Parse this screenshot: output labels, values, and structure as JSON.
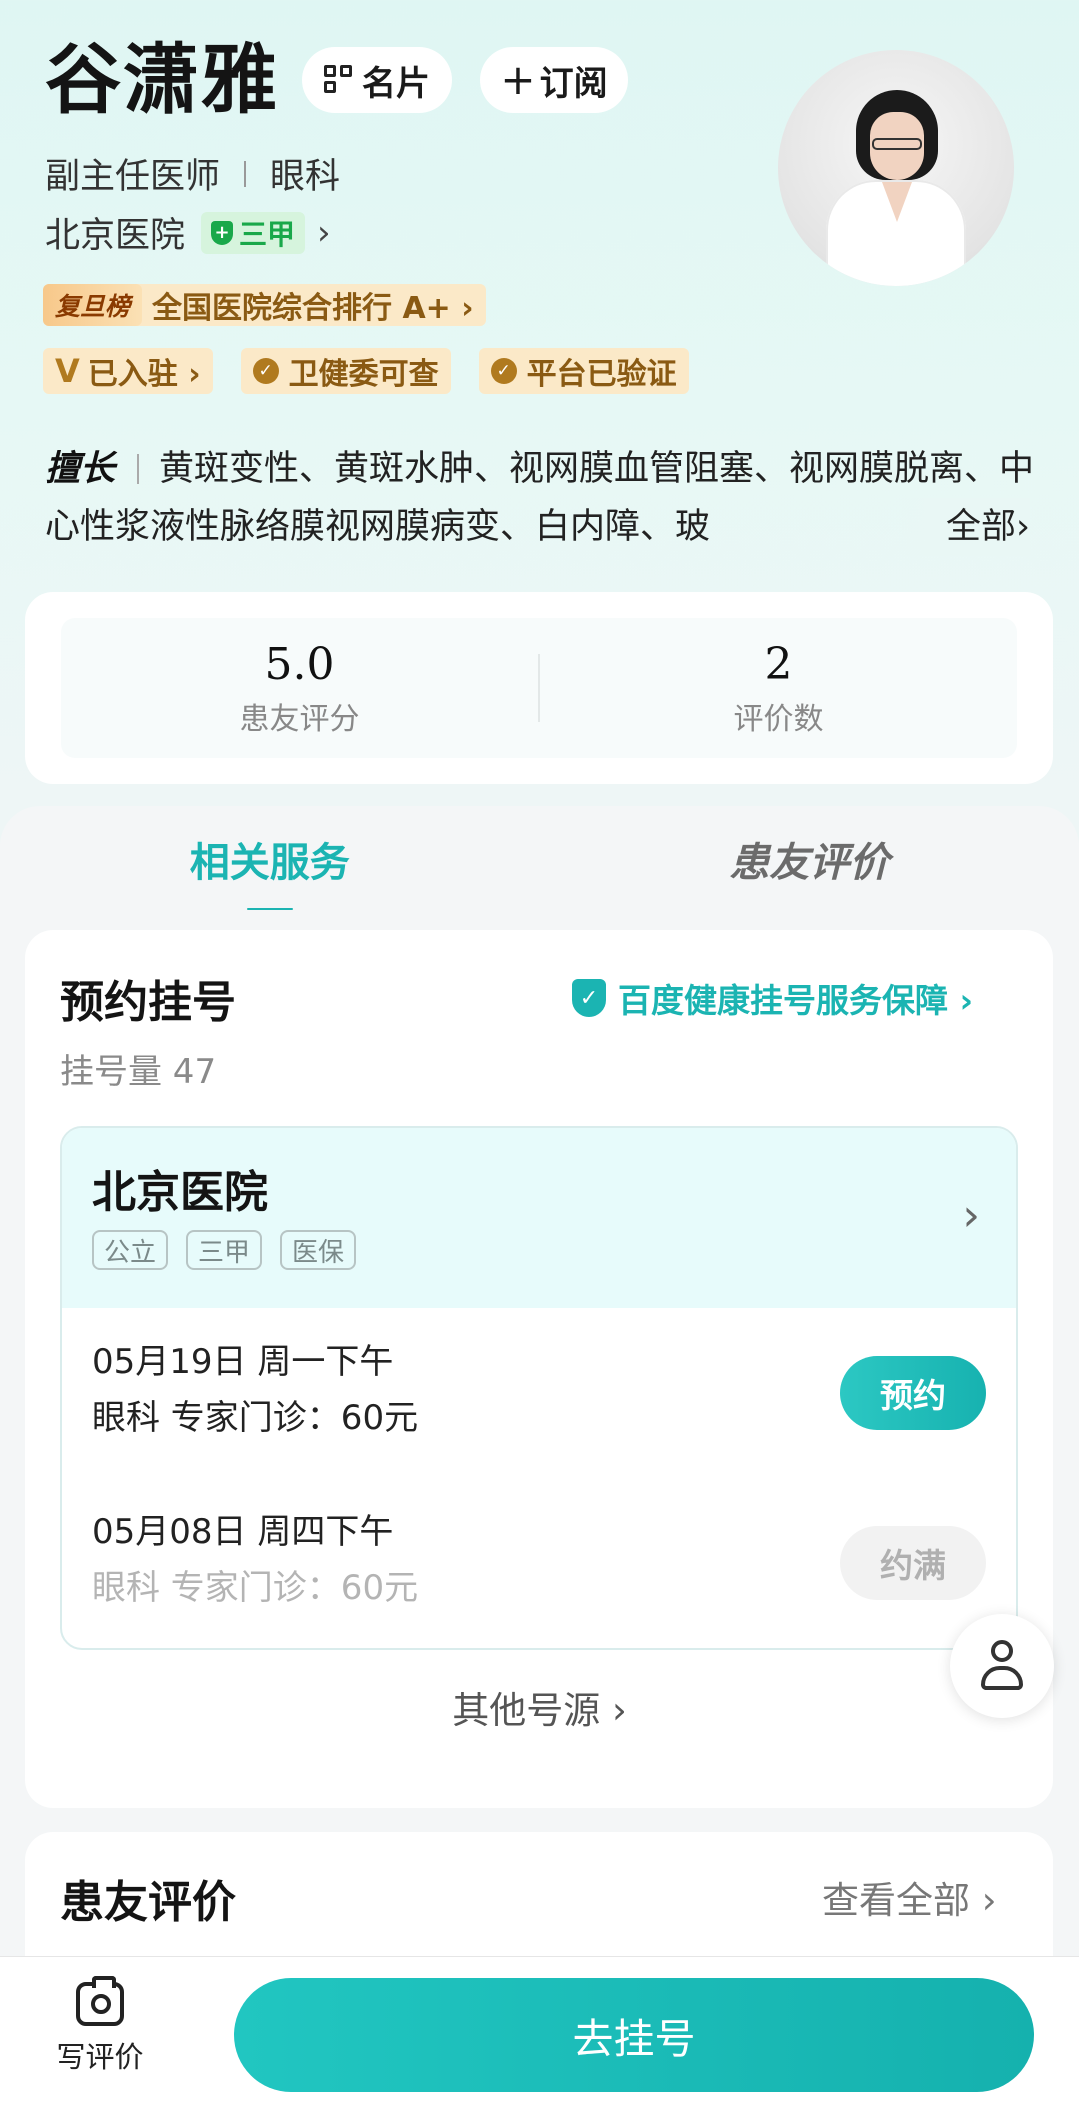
{
  "doctor": {
    "name": "谷潇雅",
    "card_label": "名片",
    "subscribe_label": "订阅",
    "title": "副主任医师",
    "department": "眼科",
    "hospital": "北京医院",
    "hospital_grade": "三甲",
    "rank_tag": "复旦榜",
    "rank_text": "全国医院综合排行 A+ ›",
    "badges": [
      "已入驻 ›",
      "卫健委可查",
      "平台已验证"
    ],
    "skill_label": "擅长",
    "skill_text": "黄斑变性、黄斑水肿、视网膜血管阻塞、视网膜脱离、中心性浆液性脉络膜视网膜病变、白内障、玻",
    "skill_more": "全部›"
  },
  "rating": {
    "score": "5.0",
    "score_label": "患友评分",
    "count": "2",
    "count_label": "评价数"
  },
  "tabs": [
    {
      "label": "相关服务",
      "active": true
    },
    {
      "label": "患友评价",
      "active": false
    }
  ],
  "appointment": {
    "title": "预约挂号",
    "guarantee": "百度健康挂号服务保障 ›",
    "count_text": "挂号量 47",
    "hospital": {
      "name": "北京医院",
      "tags": [
        "公立",
        "三甲",
        "医保"
      ]
    },
    "slots": [
      {
        "date": "05月19日  周一下午",
        "info": "眼科  专家门诊：60元",
        "button": "预约",
        "available": true
      },
      {
        "date": "05月08日  周四下午",
        "info": "眼科  专家门诊：60元",
        "button": "约满",
        "available": false
      }
    ],
    "other_sources": "其他号源  ›"
  },
  "reviews": {
    "title": "患友评价",
    "view_all": "查看全部 ›"
  },
  "bottom": {
    "write_review": "写评价",
    "go_register": "去挂号"
  },
  "colors": {
    "accent": "#1bb4b2",
    "badge_bg": "#fbe9c8",
    "badge_text": "#8a5a13",
    "grade_green": "#19a84a"
  },
  "icons": {
    "card": "qr-code-icon",
    "subscribe": "plus-icon",
    "grade": "hospital-cross-icon",
    "guarantee": "shield-check-icon",
    "float": "person-icon",
    "write_review": "camera-icon"
  }
}
